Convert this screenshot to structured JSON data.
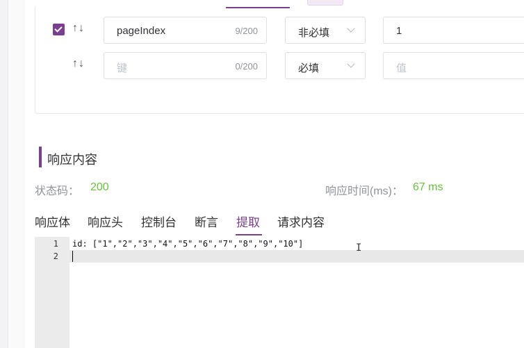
{
  "params": {
    "rows": [
      {
        "checked": true,
        "sort_icon": "↑↓",
        "key_value": "pageIndex",
        "key_placeholder": "",
        "key_count": "9/200",
        "required": "非必填",
        "value": "1",
        "value_placeholder": ""
      },
      {
        "checked": false,
        "sort_icon": "↑↓",
        "key_value": "",
        "key_placeholder": "键",
        "key_count": "0/200",
        "required": "必填",
        "value": "",
        "value_placeholder": "值"
      }
    ]
  },
  "response": {
    "title": "响应内容",
    "status_label": "状态码：",
    "status_value": "200",
    "time_label": "响应时间(ms)：",
    "time_value": "67 ms"
  },
  "tabs": [
    {
      "label": "响应体",
      "active": false
    },
    {
      "label": "响应头",
      "active": false
    },
    {
      "label": "控制台",
      "active": false
    },
    {
      "label": "断言",
      "active": false
    },
    {
      "label": "提取",
      "active": true
    },
    {
      "label": "请求内容",
      "active": false
    }
  ],
  "editor": {
    "lines": [
      {
        "no": "1",
        "text": "id: [\"1\",\"2\",\"3\",\"4\",\"5\",\"6\",\"7\",\"8\",\"9\",\"10\"]"
      },
      {
        "no": "2",
        "text": ""
      }
    ],
    "cursor_icon": "I"
  },
  "colors": {
    "accent": "#7b3f8f",
    "success": "#67c23a",
    "muted": "#909399"
  }
}
